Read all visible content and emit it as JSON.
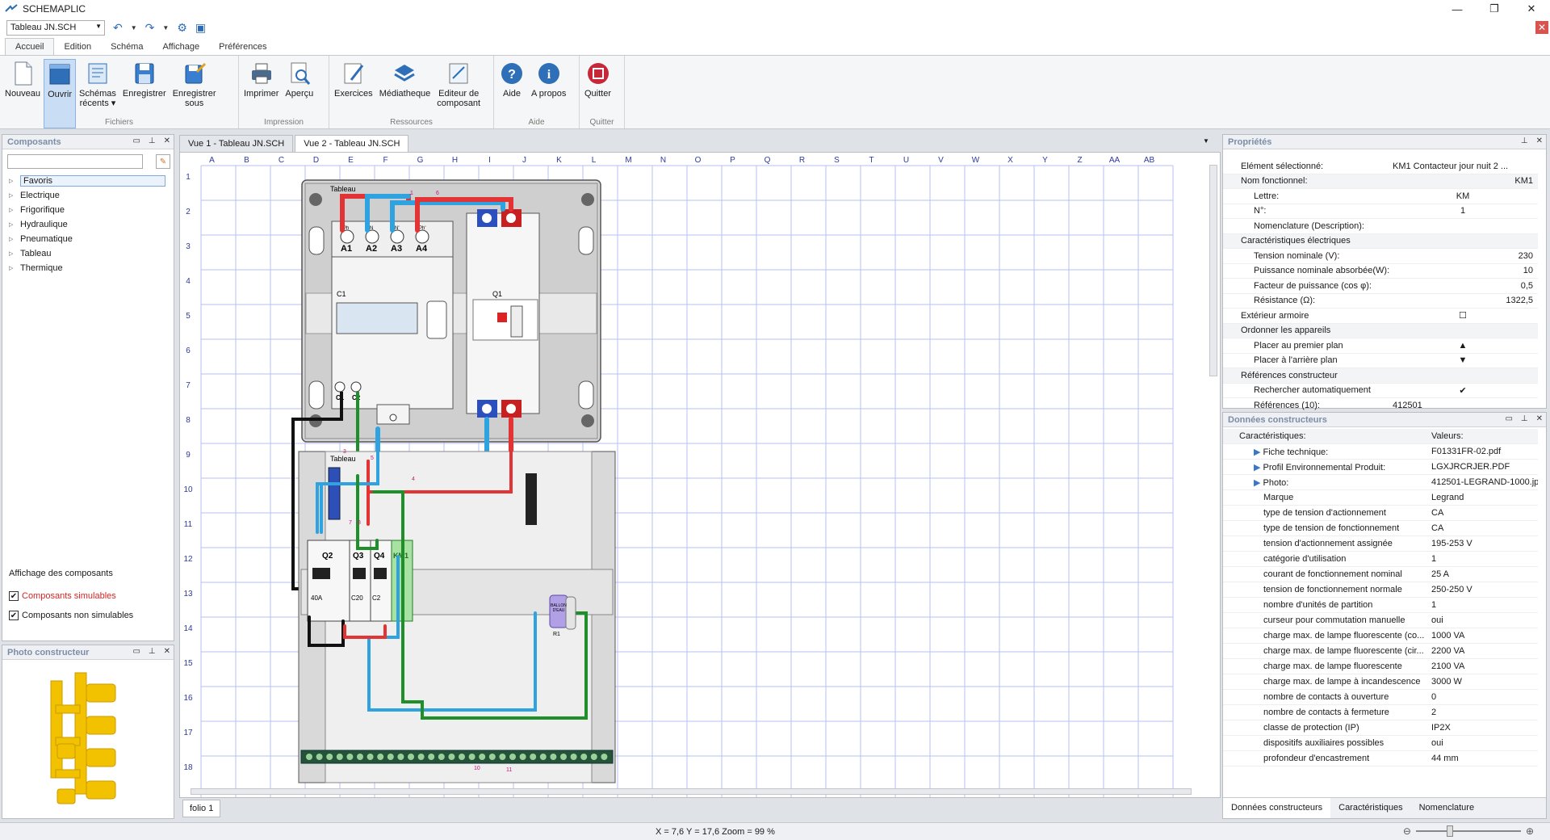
{
  "window": {
    "title": "SCHEMAPLIC",
    "controls": [
      "—",
      "❐",
      "✕"
    ]
  },
  "quick_access": {
    "file": "Tableau JN.SCH"
  },
  "ribbon_tabs": [
    "Accueil",
    "Edition",
    "Schéma",
    "Affichage",
    "Préférences"
  ],
  "ribbon_groups": [
    {
      "label": "Fichiers",
      "buttons": [
        "Nouveau",
        "Ouvrir",
        "Schémas\nrécents ▾",
        "Enregistrer",
        "Enregistrer\nsous"
      ]
    },
    {
      "label": "Impression",
      "buttons": [
        "Imprimer",
        "Aperçu"
      ]
    },
    {
      "label": "Ressources",
      "buttons": [
        "Exercices",
        "Médiatheque",
        "Editeur de\ncomposant"
      ]
    },
    {
      "label": "Aide",
      "buttons": [
        "Aide",
        "A propos"
      ]
    },
    {
      "label": "Quitter",
      "buttons": [
        "Quitter"
      ]
    }
  ],
  "components_panel": {
    "title": "Composants",
    "tree": [
      "Favoris",
      "Electrique",
      "Frigorifique",
      "Hydraulique",
      "Pneumatique",
      "Tableau",
      "Thermique"
    ],
    "display_label": "Affichage des composants",
    "check_simulable": "Composants simulables",
    "check_non_simulable": "Composants non simulables"
  },
  "photo_panel": {
    "title": "Photo constructeur"
  },
  "doc_tabs": [
    "Vue 1 - Tableau JN.SCH",
    "Vue 2 - Tableau JN.SCH"
  ],
  "canvas": {
    "columns": [
      "A",
      "B",
      "C",
      "D",
      "E",
      "F",
      "G",
      "H",
      "I",
      "J",
      "K",
      "L",
      "M",
      "N",
      "O",
      "P",
      "Q",
      "R",
      "S",
      "T",
      "U",
      "V",
      "W",
      "X",
      "Y",
      "Z",
      "AA",
      "AB"
    ],
    "rows": [
      "1",
      "2",
      "3",
      "4",
      "5",
      "6",
      "7",
      "8",
      "9",
      "10",
      "11",
      "12",
      "13",
      "14",
      "15",
      "16",
      "17",
      "18"
    ],
    "labels": {
      "tableau_top": "Tableau",
      "tableau_bottom": "Tableau",
      "c1": "C1",
      "q1": "Q1",
      "a1": "A1",
      "a2": "A2",
      "a3": "A3",
      "a4": "A4",
      "ph": "Ph",
      "n": "N",
      "n2": "N'",
      "ph2": "Ph'",
      "cc1": "C1",
      "cc2": "C2",
      "q2": "Q2",
      "q3": "Q3",
      "q4": "Q4",
      "km1": "KM1",
      "a40": "40A",
      "c20": "C20",
      "c2": "C2",
      "ballon": "BALLON\nD'EAU",
      "r1": "R1",
      "wire1": "1",
      "wire3": "3",
      "wire4": "4",
      "wire5": "5",
      "wire6": "6",
      "wire7": "7",
      "wire8": "8",
      "wire10": "10",
      "wire11": "11"
    }
  },
  "folio": "folio 1",
  "status": {
    "coords": "X = 7,6 Y = 17,6 Zoom = 99 %"
  },
  "properties_panel": {
    "title": "Propriétés",
    "rows": [
      {
        "type": "row",
        "k": "Elément sélectionné:",
        "v": "KM1 Contacteur jour nuit 2 ..."
      },
      {
        "type": "cat",
        "k": "Nom fonctionnel:",
        "v": "KM1"
      },
      {
        "type": "sub",
        "k": "Lettre:",
        "v": "KM",
        "align": "c"
      },
      {
        "type": "sub",
        "k": "N°:",
        "v": "1",
        "align": "c"
      },
      {
        "type": "sub",
        "k": "Nomenclature (Description):",
        "v": ""
      },
      {
        "type": "cat",
        "k": "Caractéristiques électriques",
        "v": ""
      },
      {
        "type": "sub",
        "k": "Tension nominale (V):",
        "v": "230",
        "align": "r"
      },
      {
        "type": "sub",
        "k": "Puissance nominale absorbée(W):",
        "v": "10",
        "align": "r"
      },
      {
        "type": "sub",
        "k": "Facteur de puissance (cos φ):",
        "v": "0,5",
        "align": "r"
      },
      {
        "type": "sub",
        "k": "Résistance (Ω):",
        "v": "1322,5",
        "align": "r"
      },
      {
        "type": "row",
        "k": "Extérieur armoire",
        "v": "☐",
        "align": "c"
      },
      {
        "type": "cat",
        "k": "Ordonner les appareils",
        "v": ""
      },
      {
        "type": "sub",
        "k": "Placer au premier plan",
        "v": "▲",
        "align": "c"
      },
      {
        "type": "sub",
        "k": "Placer à l'arrière plan",
        "v": "▼",
        "align": "c"
      },
      {
        "type": "cat",
        "k": "Références constructeur",
        "v": ""
      },
      {
        "type": "sub",
        "k": "Rechercher automatiquement",
        "v": "✔",
        "align": "c"
      },
      {
        "type": "sub",
        "k": "Références (10):",
        "v": "412501"
      }
    ]
  },
  "maker_panel": {
    "title": "Données constructeurs",
    "head_k": "Caractéristiques:",
    "head_v": "Valeurs:",
    "rows": [
      {
        "k": "Fiche technique:",
        "v": "F01331FR-02.pdf",
        "link": true
      },
      {
        "k": "Profil Environnemental Produit:",
        "v": "LGXJRCRJER.PDF",
        "link": true
      },
      {
        "k": "Photo:",
        "v": "412501-LEGRAND-1000.jpg",
        "link": true
      },
      {
        "k": "Marque",
        "v": "Legrand"
      },
      {
        "k": "type de tension d'actionnement",
        "v": "CA"
      },
      {
        "k": "type de tension de fonctionnement",
        "v": "CA"
      },
      {
        "k": "tension d'actionnement assignée",
        "v": "195-253 V"
      },
      {
        "k": "catégorie d'utilisation",
        "v": "1"
      },
      {
        "k": "courant de fonctionnement nominal",
        "v": "25 A"
      },
      {
        "k": "tension de fonctionnement normale",
        "v": "250-250 V"
      },
      {
        "k": "nombre d'unités de partition",
        "v": "1"
      },
      {
        "k": "curseur pour commutation manuelle",
        "v": "oui"
      },
      {
        "k": "charge max. de lampe fluorescente (co...",
        "v": "1000 VA"
      },
      {
        "k": "charge max. de lampe fluorescente (cir...",
        "v": "2200 VA"
      },
      {
        "k": "charge max. de lampe fluorescente",
        "v": "2100 VA"
      },
      {
        "k": "charge max. de lampe à incandescence",
        "v": "3000 W"
      },
      {
        "k": "nombre de contacts à ouverture",
        "v": "0"
      },
      {
        "k": "nombre de contacts à fermeture",
        "v": "2"
      },
      {
        "k": "classe de protection (IP)",
        "v": "IP2X"
      },
      {
        "k": "dispositifs auxiliaires possibles",
        "v": "oui"
      },
      {
        "k": "profondeur d'encastrement",
        "v": "44 mm"
      }
    ],
    "tabs": [
      "Données constructeurs",
      "Caractéristiques",
      "Nomenclature"
    ]
  }
}
